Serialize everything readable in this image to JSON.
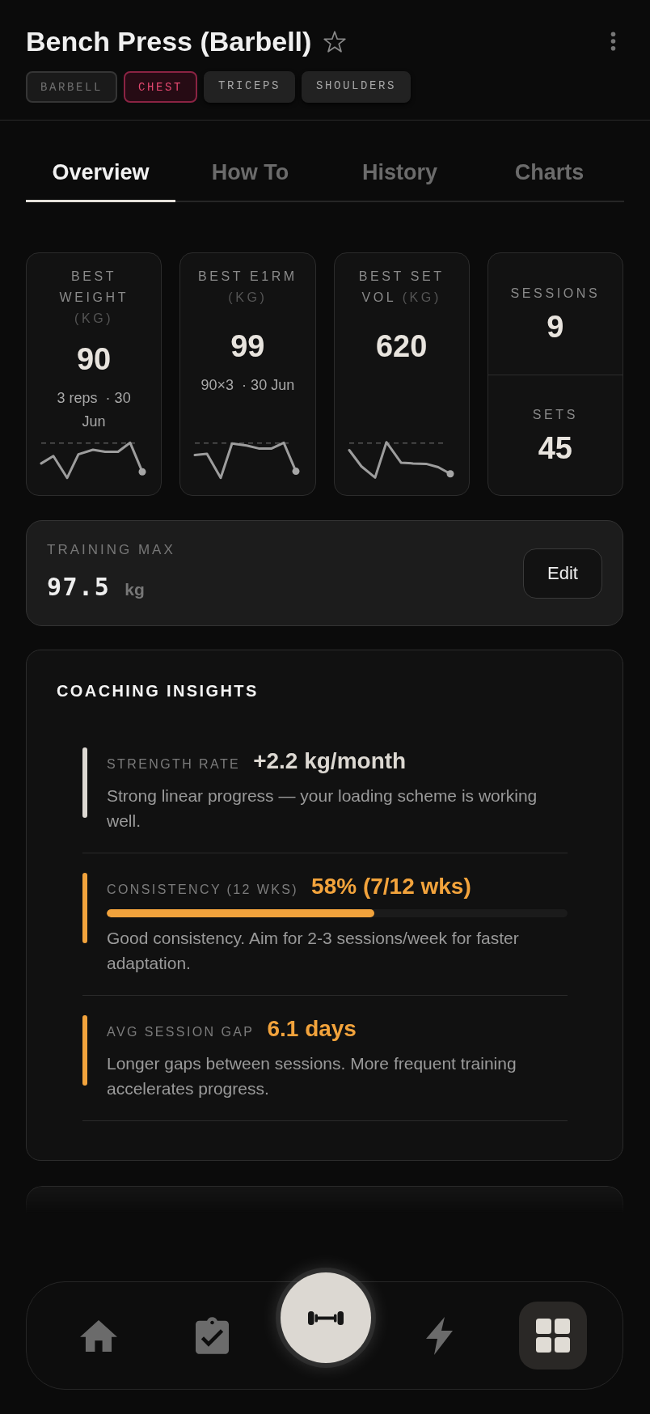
{
  "header": {
    "title": "Bench Press (Barbell)",
    "starred": false,
    "tags": [
      {
        "label": "BARBELL",
        "kind": "equipment"
      },
      {
        "label": "CHEST",
        "kind": "primary"
      },
      {
        "label": "TRICEPS",
        "kind": "secondary"
      },
      {
        "label": "SHOULDERS",
        "kind": "secondary"
      }
    ]
  },
  "tabs": [
    {
      "label": "Overview",
      "selected": true
    },
    {
      "label": "How To",
      "selected": false
    },
    {
      "label": "History",
      "selected": false
    },
    {
      "label": "Charts",
      "selected": false
    }
  ],
  "stats": [
    {
      "kind": "record",
      "label": "BEST WEIGHT",
      "unit": "(KG)",
      "value": "90",
      "detail": "3 reps  · 30 Jun"
    },
    {
      "kind": "record",
      "label": "BEST E1RM",
      "unit": "(KG)",
      "value": "99",
      "detail": "90×3  · 30 Jun"
    },
    {
      "kind": "record",
      "label": "BEST SET VOL",
      "unit": "(KG)",
      "value": "620"
    },
    {
      "kind": "split",
      "items": [
        {
          "label": "SESSIONS",
          "value": "9"
        },
        {
          "label": "SETS",
          "value": "45"
        }
      ]
    }
  ],
  "training_max": {
    "label": "TRAINING MAX",
    "value": "97.5",
    "unit": "kg",
    "button": "Edit"
  },
  "coaching": {
    "title": "COACHING INSIGHTS",
    "insights": [
      {
        "kind": "text",
        "label": "STRENGTH RATE",
        "value": "+2.2 kg/month",
        "color": "#dcd8d2",
        "text": "Strong linear progress — your loading scheme is working well."
      },
      {
        "kind": "meter",
        "label": "CONSISTENCY (12 WKS)",
        "value": "58% (7/12 wks)",
        "color": "#f2a33c",
        "level": 0.58,
        "text": "Good consistency. Aim for 2-3 sessions/week for faster adaptation."
      },
      {
        "kind": "text",
        "label": "AVG SESSION GAP",
        "value": "6.1 days",
        "color": "#f2a33c",
        "text": "Longer gaps between sessions. More frequent training accelerates progress."
      }
    ]
  },
  "bottom_nav": {
    "items": [
      {
        "kind": "tab",
        "selected": false
      },
      {
        "kind": "tab",
        "selected": false
      },
      {
        "kind": "action"
      },
      {
        "kind": "tab",
        "selected": false
      },
      {
        "kind": "tab",
        "selected": true
      }
    ]
  }
}
